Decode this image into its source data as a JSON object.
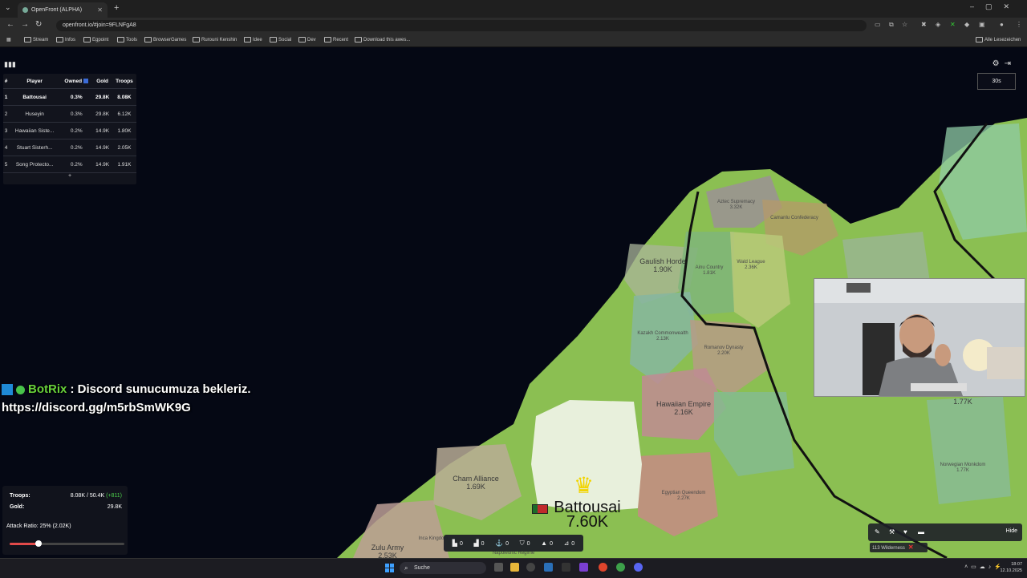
{
  "browser": {
    "tab_title": "OpenFront (ALPHA)",
    "url": "openfront.io/#join=9FLNFgA8",
    "bookmarks": [
      "Stream",
      "Infos",
      "Egpoint",
      "Tools",
      "BrowserGames",
      "Rurouni Kenshin",
      "Idee",
      "Social",
      "Dev",
      "Recent",
      "Download this awes..."
    ],
    "all_bookmarks": "Alle Lesezeichen"
  },
  "leaderboard": {
    "headers": [
      "#",
      "Player",
      "Owned",
      "Gold",
      "Troops"
    ],
    "rows": [
      {
        "rank": "1",
        "player": "Battousai",
        "owned": "0.3%",
        "gold": "29.8K",
        "troops": "8.08K"
      },
      {
        "rank": "2",
        "player": "Huseyin",
        "owned": "0.3%",
        "gold": "29.8K",
        "troops": "6.12K"
      },
      {
        "rank": "3",
        "player": "Hawaiian Siste...",
        "owned": "0.2%",
        "gold": "14.9K",
        "troops": "1.80K"
      },
      {
        "rank": "4",
        "player": "Stuart Sisterh...",
        "owned": "0.2%",
        "gold": "14.9K",
        "troops": "2.05K"
      },
      {
        "rank": "5",
        "player": "Song Protecto...",
        "owned": "0.2%",
        "gold": "14.9K",
        "troops": "1.91K"
      }
    ],
    "more": "+"
  },
  "timer": "30s",
  "chat": {
    "user": "BotRix",
    "message": ": Discord sunucumuza bekleriz.",
    "link": "https://discord.gg/m5rbSmWK9G"
  },
  "map": {
    "player": {
      "name": "Battousai",
      "troops": "7.60K"
    },
    "territories": [
      {
        "name": "Aztec Supremacy",
        "troops": "3.32K"
      },
      {
        "name": "Camanlu Confederacy",
        "troops": ""
      },
      {
        "name": "Gaulish Horde",
        "troops": "1.90K"
      },
      {
        "name": "Ainu Country",
        "troops": "1.81K"
      },
      {
        "name": "Wald League",
        "troops": "2.36K"
      },
      {
        "name": "Kazakh Commonwealth",
        "troops": "2.13K"
      },
      {
        "name": "Romanov Dynasty",
        "troops": "2.20K"
      },
      {
        "name": "Hawaiian Empire",
        "troops": "2.16K"
      },
      {
        "name": "Cham Alliance",
        "troops": "1.69K"
      },
      {
        "name": "Egyptian Queendom",
        "troops": "2.27K"
      },
      {
        "name": "Zulu Army",
        "troops": "2.53K"
      },
      {
        "name": "Norwegian Monkdom",
        "troops": "1.77K"
      },
      {
        "name": "Inca Kingdom",
        "troops": ""
      },
      {
        "name": "Napoleonic Regime",
        "troops": ""
      }
    ],
    "unlabeled_troops": "1.77K"
  },
  "stats": {
    "troops_label": "Troops:",
    "troops_value": "8.08K / 50.4K",
    "troops_increase": "(+811)",
    "gold_label": "Gold:",
    "gold_value": "29.8K",
    "attack_label": "Attack Ratio: 25% (2.02K)",
    "attack_ratio": 0.25
  },
  "units": [
    {
      "icon": "city-icon",
      "value": "0"
    },
    {
      "icon": "factory-icon",
      "value": "0"
    },
    {
      "icon": "port-icon",
      "value": "0"
    },
    {
      "icon": "defense-post-icon",
      "value": "0"
    },
    {
      "icon": "missile-silo-icon",
      "value": "0"
    },
    {
      "icon": "sam-launcher-icon",
      "value": "0"
    }
  ],
  "controls": {
    "hide": "Hide",
    "wilderness": "113 Wilderness"
  },
  "taskbar": {
    "search": "Suche",
    "time": "18:07",
    "date": "12.10.2025"
  },
  "colors": {
    "ocean": "#050814",
    "land": "#8bbf52",
    "player_territory": "#e8f0dc",
    "accent_green": "#67d13a",
    "attack_red": "#e24a4a"
  }
}
